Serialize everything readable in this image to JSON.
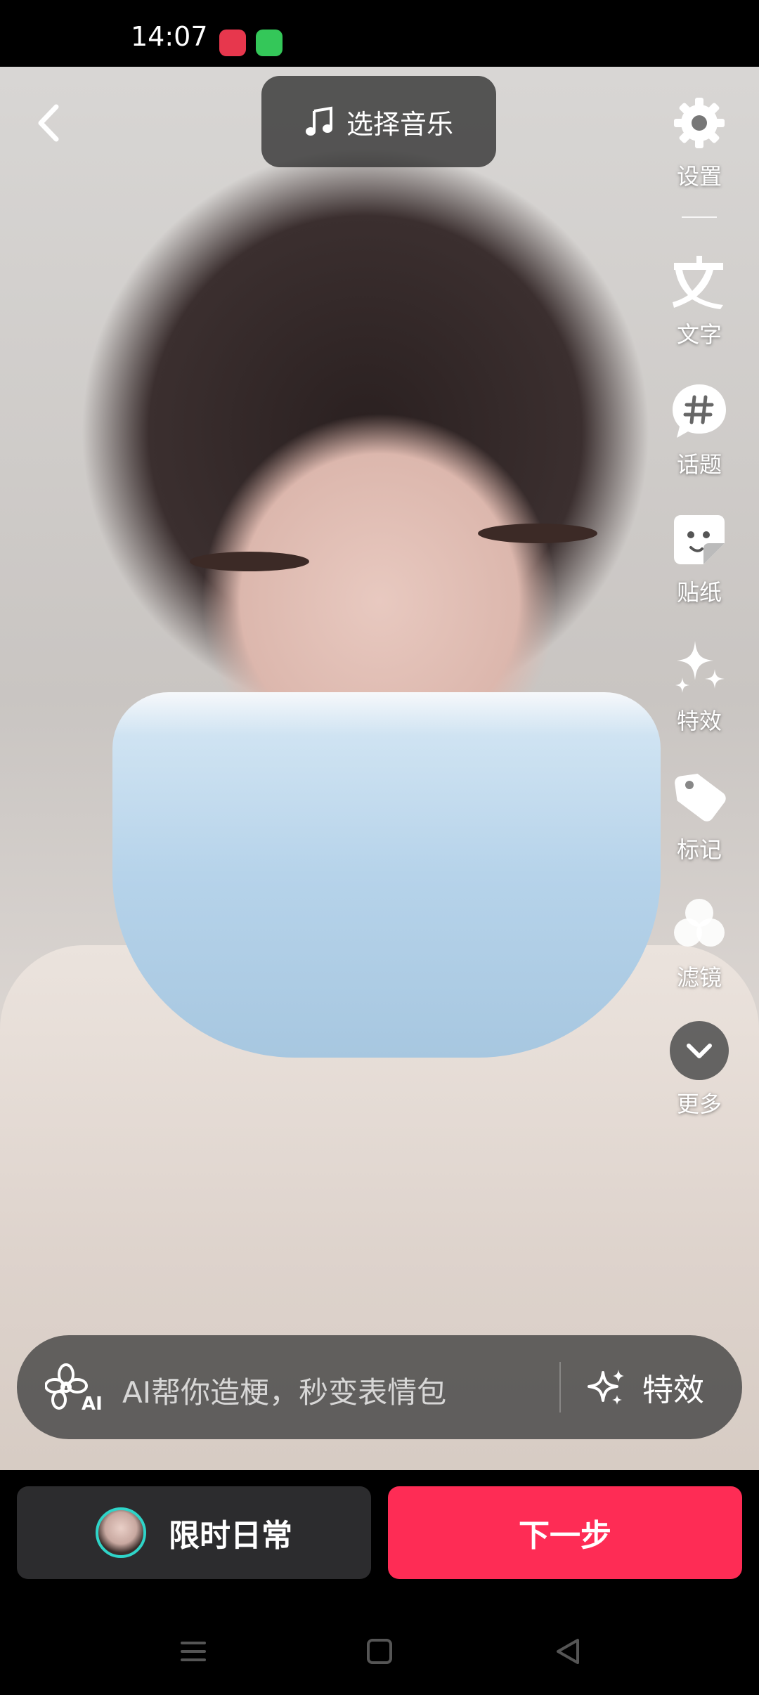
{
  "status_bar": {
    "time": "14:07"
  },
  "top": {
    "music_label": "选择音乐"
  },
  "sidebar": {
    "items": [
      {
        "label": "设置",
        "icon": "gear-icon"
      },
      {
        "label": "文字",
        "icon": "text-icon"
      },
      {
        "label": "话题",
        "icon": "hashtag-icon"
      },
      {
        "label": "贴纸",
        "icon": "sticker-icon"
      },
      {
        "label": "特效",
        "icon": "sparkle-icon"
      },
      {
        "label": "标记",
        "icon": "tag-icon"
      },
      {
        "label": "滤镜",
        "icon": "filter-icon"
      },
      {
        "label": "更多",
        "icon": "chevron-down-icon"
      }
    ]
  },
  "ai_bar": {
    "placeholder": "AI帮你造梗，秒变表情包",
    "effect_label": "特效"
  },
  "bottom": {
    "daily_label": "限时日常",
    "next_label": "下一步"
  },
  "colors": {
    "accent": "#fe2c55",
    "avatar_ring": "#2fd4c8"
  }
}
